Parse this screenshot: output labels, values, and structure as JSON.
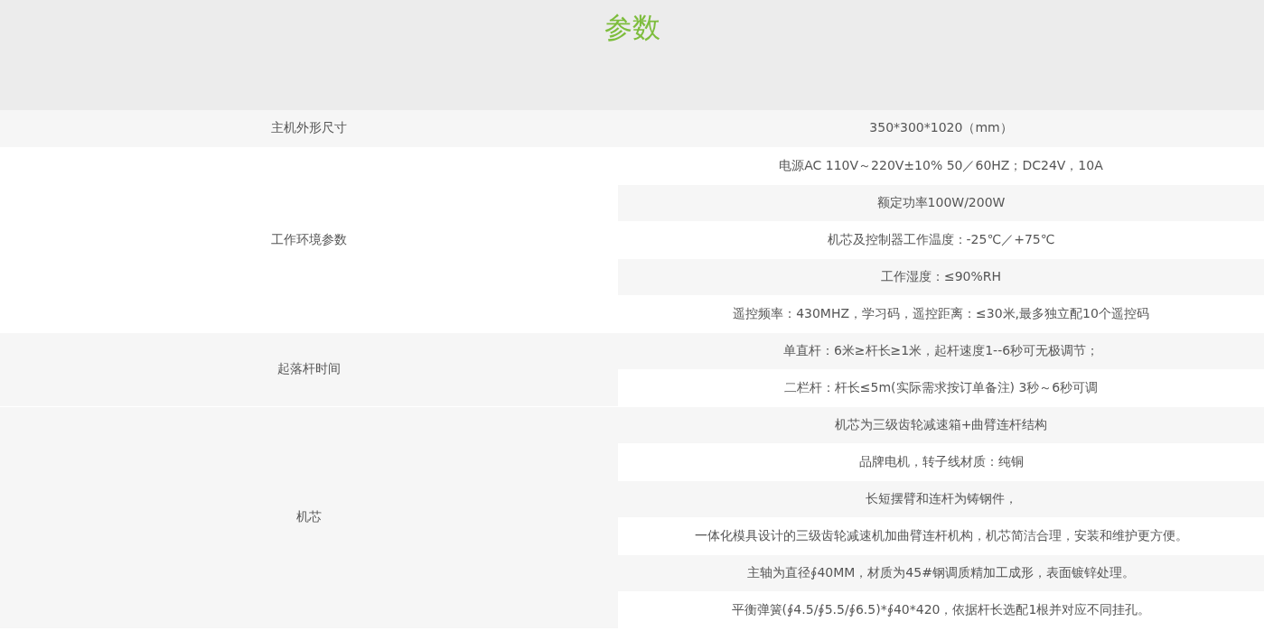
{
  "title": "参数",
  "specs": [
    {
      "label": "主机外形尺寸",
      "values": [
        "350*300*1020（mm）"
      ]
    },
    {
      "label": "工作环境参数",
      "values": [
        "电源AC 110V～220V±10% 50／60HZ；DC24V，10A",
        "额定功率100W/200W",
        "机芯及控制器工作温度：-25℃／+75℃",
        "工作湿度：≤90%RH",
        "遥控频率：430MHZ，学习码，遥控距离：≤30米,最多独立配10个遥控码"
      ]
    },
    {
      "label": "起落杆时间",
      "values": [
        "单直杆：6米≥杆长≥1米，起杆速度1--6秒可无极调节；",
        "二栏杆：杆长≤5m(实际需求按订单备注) 3秒～6秒可调"
      ]
    },
    {
      "label": "机芯",
      "values": [
        "机芯为三级齿轮减速箱+曲臂连杆结构",
        "品牌电机，转子线材质：纯铜",
        "长短摆臂和连杆为铸钢件，",
        "一体化模具设计的三级齿轮减速机加曲臂连杆机构，机芯简洁合理，安装和维护更方便。",
        "主轴为直径∮40MM，材质为45#钢调质精加工成形，表面镀锌处理。",
        "平衡弹簧(∮4.5/∮5.5/∮6.5)*∮40*420，依据杆长选配1根并对应不同挂孔。"
      ]
    }
  ]
}
